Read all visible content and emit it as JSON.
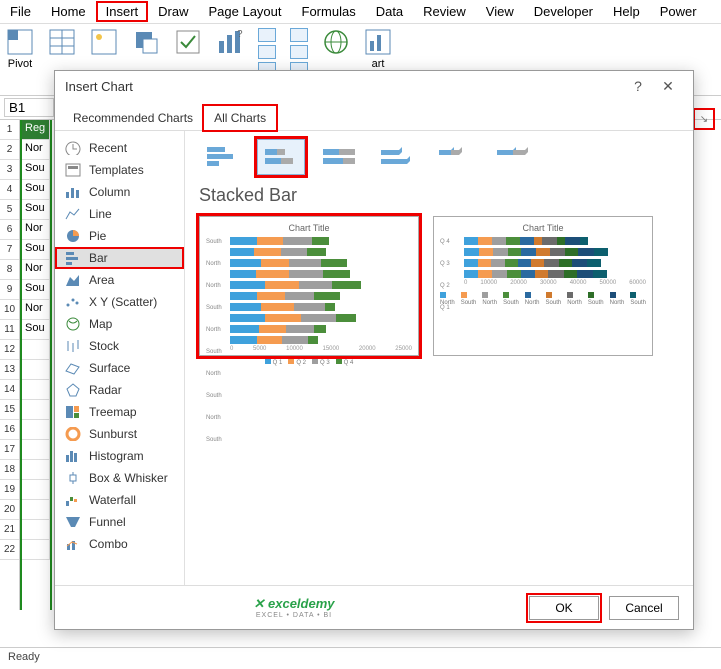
{
  "menu": {
    "items": [
      "File",
      "Home",
      "Insert",
      "Draw",
      "Page Layout",
      "Formulas",
      "Data",
      "Review",
      "View",
      "Developer",
      "Help",
      "Power"
    ],
    "highlighted": "Insert"
  },
  "ribbon": {
    "pivot_label": "Pivot",
    "chart_suffix": "art"
  },
  "formula": {
    "namebox": "B1"
  },
  "sheet": {
    "col_hdr": "Reg",
    "rows": [
      "Nor",
      "Sou",
      "Sou",
      "Sou",
      "Nor",
      "Sou",
      "Nor",
      "Sou",
      "Nor",
      "Sou"
    ]
  },
  "status": {
    "ready": "Ready"
  },
  "dialog": {
    "title": "Insert Chart",
    "tabs": {
      "recommended": "Recommended Charts",
      "all": "All Charts"
    },
    "nav": [
      "Recent",
      "Templates",
      "Column",
      "Line",
      "Pie",
      "Bar",
      "Area",
      "X Y (Scatter)",
      "Map",
      "Stock",
      "Surface",
      "Radar",
      "Treemap",
      "Sunburst",
      "Histogram",
      "Box & Whisker",
      "Waterfall",
      "Funnel",
      "Combo"
    ],
    "selected_nav": "Bar",
    "chart_name": "Stacked Bar",
    "preview_title": "Chart Title",
    "ok": "OK",
    "cancel": "Cancel",
    "logo": "exceldemy",
    "logo_sub": "EXCEL • DATA • BI"
  },
  "chart_data": [
    {
      "type": "bar",
      "title": "Chart Title",
      "orientation": "horizontal",
      "stacked": true,
      "categories": [
        "South",
        "North",
        "North",
        "South",
        "North",
        "South",
        "North",
        "South",
        "North",
        "South"
      ],
      "series": [
        {
          "name": "Q 1",
          "color": "#3fa1dc",
          "values": [
            4000,
            3500,
            4500,
            3800,
            5200,
            4000,
            4600,
            5100,
            4200,
            3900
          ]
        },
        {
          "name": "Q 2",
          "color": "#f59b50",
          "values": [
            3800,
            4000,
            4200,
            4900,
            5000,
            4100,
            4800,
            5300,
            4000,
            3800
          ]
        },
        {
          "name": "Q 3",
          "color": "#9e9e9e",
          "values": [
            4200,
            3800,
            4700,
            5000,
            4800,
            4200,
            4600,
            5200,
            4100,
            3700
          ]
        },
        {
          "name": "Q 4",
          "color": "#4b8e3b",
          "values": [
            2500,
            2800,
            3800,
            4000,
            4200,
            3900,
            1500,
            3000,
            1800,
            1600
          ]
        }
      ],
      "xticks": [
        0,
        5000,
        10000,
        15000,
        20000,
        25000
      ],
      "xlim": [
        0,
        25000
      ]
    },
    {
      "type": "bar",
      "title": "Chart Title",
      "orientation": "horizontal",
      "stacked": true,
      "categories": [
        "Q 4",
        "Q 3",
        "Q 2",
        "Q 1"
      ],
      "series": [
        {
          "name": "North",
          "color": "#3fa1dc",
          "values": [
            5000,
            5200,
            4800,
            5100
          ]
        },
        {
          "name": "South",
          "color": "#f59b50",
          "values": [
            4800,
            5000,
            4600,
            4900
          ]
        },
        {
          "name": "North",
          "color": "#9e9e9e",
          "values": [
            5200,
            5400,
            5000,
            5300
          ]
        },
        {
          "name": "South",
          "color": "#4b8e3b",
          "values": [
            4600,
            4700,
            4500,
            4800
          ]
        },
        {
          "name": "North",
          "color": "#2a6aa0",
          "values": [
            5000,
            5100,
            4900,
            5000
          ]
        },
        {
          "name": "South",
          "color": "#d07a2e",
          "values": [
            3000,
            4800,
            4600,
            4700
          ]
        },
        {
          "name": "North",
          "color": "#6b6b6b",
          "values": [
            5100,
            5300,
            5200,
            5400
          ]
        },
        {
          "name": "South",
          "color": "#2e6e28",
          "values": [
            3000,
            4900,
            4700,
            4800
          ]
        },
        {
          "name": "North",
          "color": "#1d4e78",
          "values": [
            5200,
            5400,
            5300,
            5500
          ]
        },
        {
          "name": "South",
          "color": "#0d5f6e",
          "values": [
            3000,
            5000,
            4800,
            5000
          ]
        }
      ],
      "xticks": [
        0,
        10000,
        20000,
        30000,
        40000,
        50000,
        60000
      ],
      "xlim": [
        0,
        60000
      ]
    }
  ]
}
